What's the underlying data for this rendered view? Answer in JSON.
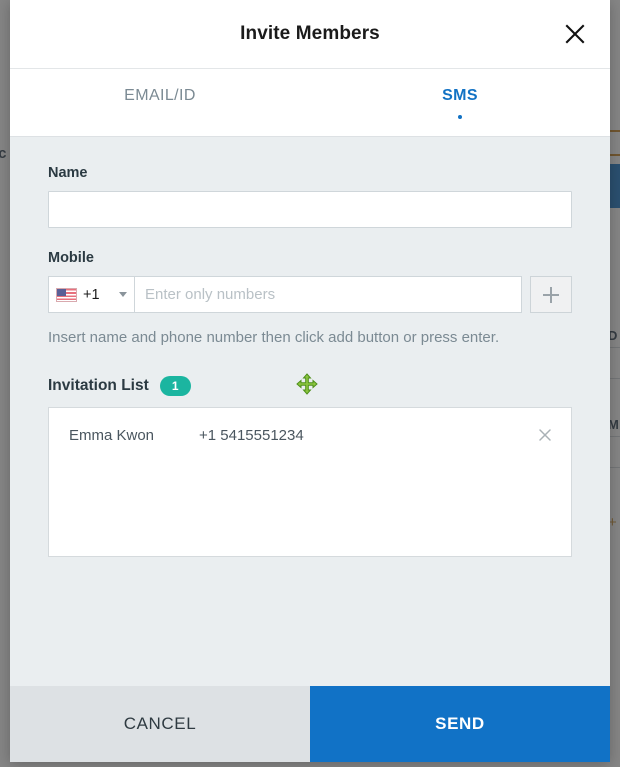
{
  "background": {
    "left_text": ".c",
    "labels": [
      "D",
      "M"
    ],
    "accent": "#1172c6"
  },
  "modal": {
    "title": "Invite Members",
    "close_icon": "close-icon",
    "tabs": [
      {
        "label": "EMAIL/ID",
        "active": false
      },
      {
        "label": "SMS",
        "active": true
      }
    ],
    "name_field": {
      "label": "Name",
      "value": "",
      "placeholder": ""
    },
    "mobile_field": {
      "label": "Mobile",
      "country_flag": "us-flag-icon",
      "country_code": "+1",
      "value": "",
      "placeholder": "Enter only numbers",
      "add_icon": "plus-icon"
    },
    "hint": "Insert name and phone number then click add button or press enter.",
    "invitation_list": {
      "title": "Invitation List",
      "count": "1",
      "badge_color": "#1bb5a0",
      "items": [
        {
          "name": "Emma Kwon",
          "phone": "+1 5415551234",
          "remove_icon": "close-icon"
        }
      ]
    },
    "footer": {
      "cancel_label": "CANCEL",
      "send_label": "SEND",
      "send_color": "#1172c6"
    }
  },
  "cursor": {
    "type": "move-cursor",
    "color": "#76c043"
  }
}
